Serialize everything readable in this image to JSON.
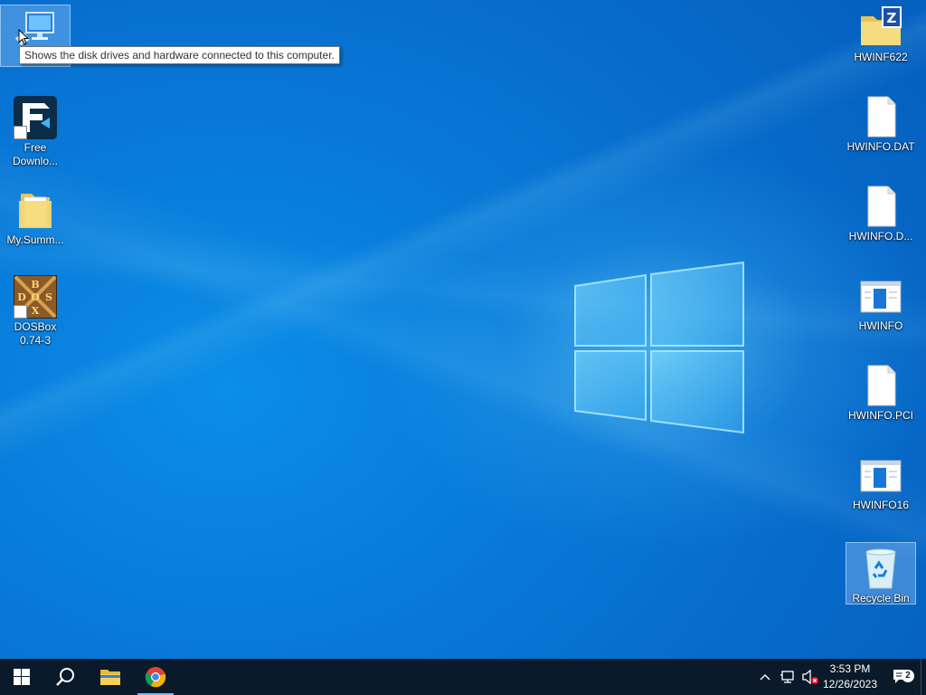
{
  "desktop": {
    "tooltip": "Shows the disk drives and hardware connected to this computer.",
    "left_icons": [
      {
        "label": ""
      },
      {
        "label": "Free Downlo..."
      },
      {
        "label": "My.Summ..."
      },
      {
        "label": "DOSBox 0.74-3"
      }
    ],
    "right_icons": [
      {
        "label": "HWINF622"
      },
      {
        "label": "HWINFO.DAT"
      },
      {
        "label": "HWINFO.D..."
      },
      {
        "label": "HWINFO"
      },
      {
        "label": "HWINFO.PCI"
      },
      {
        "label": "HWINFO16"
      },
      {
        "label": "Recycle Bin"
      }
    ]
  },
  "taskbar": {
    "pinned": [
      {
        "icon": "windows-start-icon"
      },
      {
        "icon": "search-icon"
      },
      {
        "icon": "file-explorer-icon"
      },
      {
        "icon": "chrome-icon"
      }
    ],
    "clock": {
      "time": "3:53 PM",
      "date": "12/26/2023"
    },
    "notification_count": "2",
    "colors": {
      "taskbar": "#0b1a2a",
      "accent": "#76b9ed"
    }
  }
}
